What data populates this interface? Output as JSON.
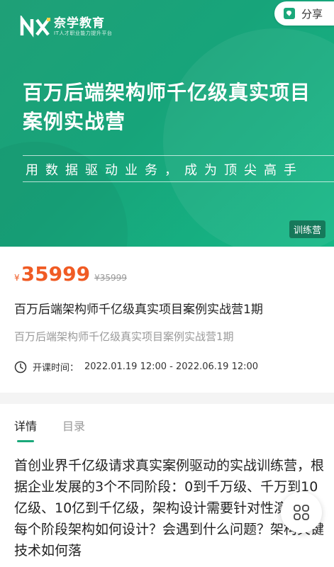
{
  "brand": {
    "logo_text": "NX",
    "name": "奈学教育",
    "tagline": "IT人才职业能力提升平台"
  },
  "header": {
    "share_label": "分享",
    "share_icon": "share-icon"
  },
  "hero": {
    "title": "百万后端架构师千亿级真实项目案例实战营",
    "slogan": "用数据驱动业务，成为顶尖高手",
    "badge": "训练营",
    "accent": "#1aa87a"
  },
  "pricing": {
    "currency": "¥",
    "current": "35999",
    "original": "¥35999",
    "price_color": "#f05b24"
  },
  "product": {
    "title": "百万后端架构师千亿级真实项目案例实战营1期",
    "subtitle": "百万后端架构师千亿级真实项目案例实战营1期",
    "time_label": "开课时间：",
    "time_value": "2022.01.19 12:00 - 2022.06.19 12:00",
    "time_icon": "clock-icon"
  },
  "tabs": [
    {
      "label": "详情",
      "active": true
    },
    {
      "label": "目录",
      "active": false
    }
  ],
  "description": "首创业界千亿级请求真实案例驱动的实战训练营，根据企业发展的3个不同阶段：0到千万级、千万到10亿级、10亿到千亿级，架构设计需要针对性演进，每个阶段架构如何设计？会遇到什么问题？架构关键技术如何落",
  "fab": {
    "icon": "grid-menu-icon"
  }
}
